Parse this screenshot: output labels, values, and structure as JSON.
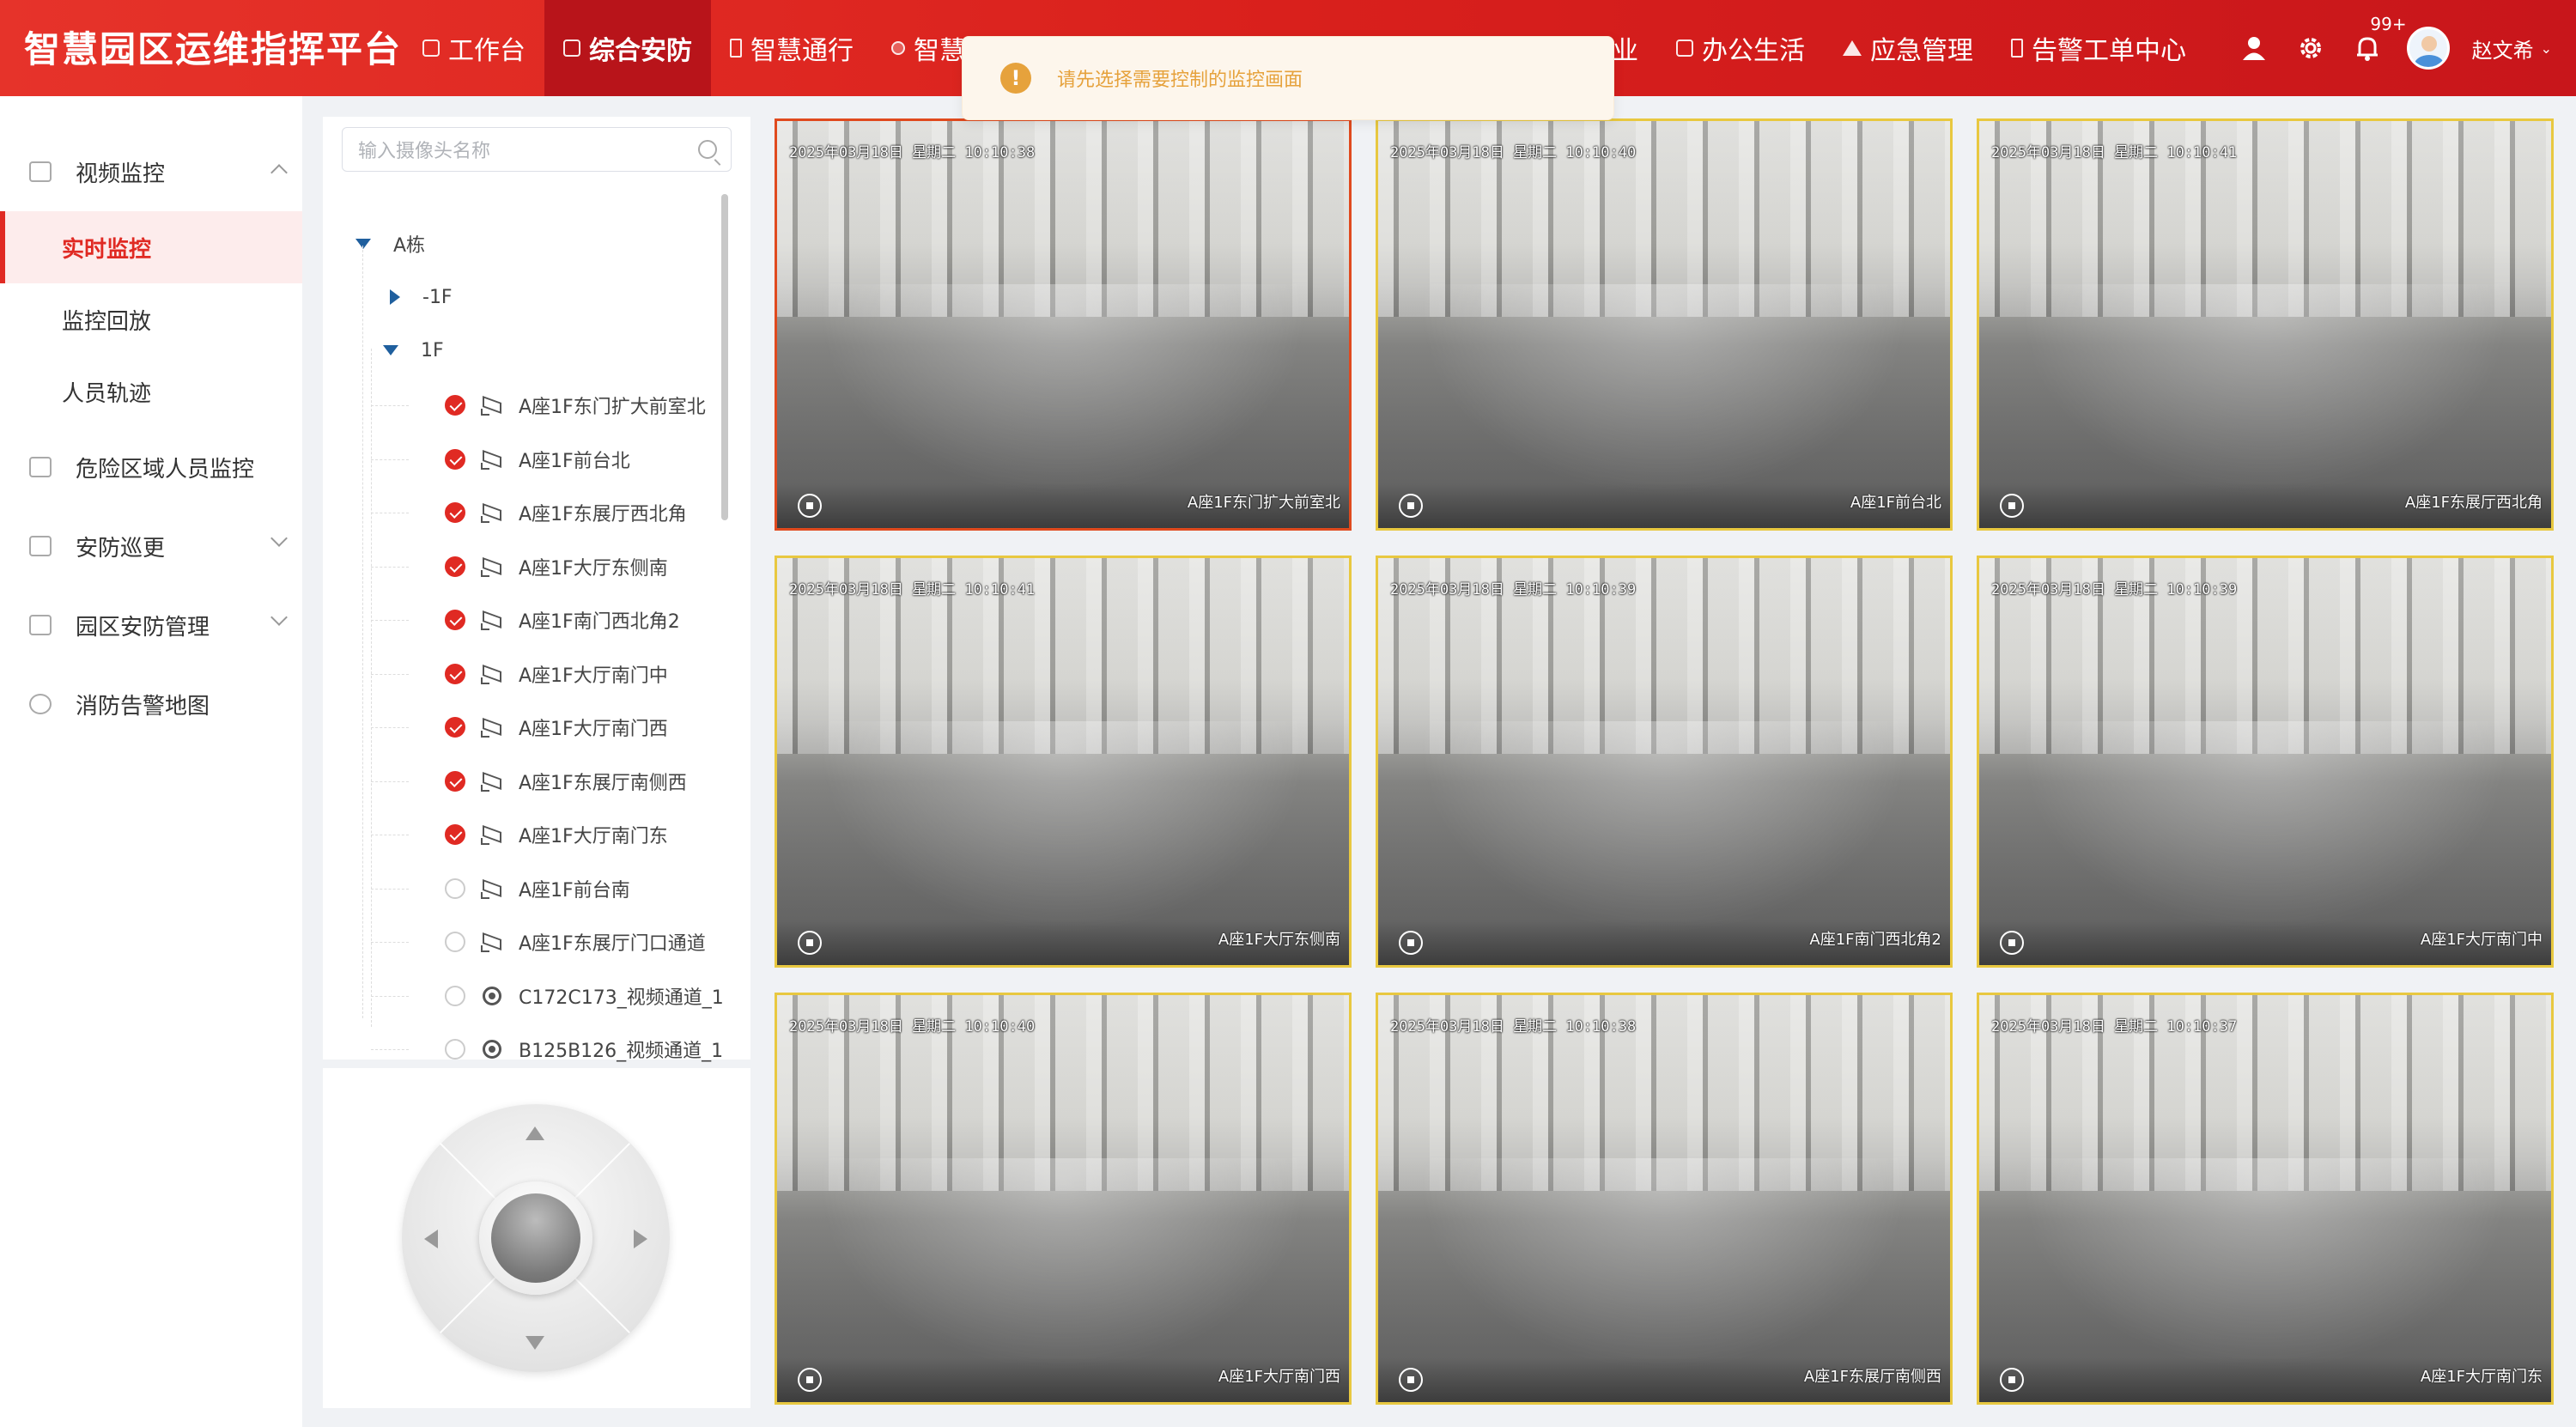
{
  "app": {
    "title": "智慧园区运维指挥平台"
  },
  "nav": [
    {
      "label": "工作台",
      "icon": "monitor-icon",
      "active": false
    },
    {
      "label": "综合安防",
      "icon": "shield-icon",
      "active": true
    },
    {
      "label": "智慧通行",
      "icon": "pass-icon",
      "active": false
    },
    {
      "label": "智慧能",
      "icon": "energy-icon",
      "active": false
    },
    {
      "label": "业",
      "icon": "",
      "active": false
    },
    {
      "label": "办公生活",
      "icon": "cup-icon",
      "active": false
    },
    {
      "label": "应急管理",
      "icon": "warning-icon",
      "active": false
    },
    {
      "label": "告警工单中心",
      "icon": "alarm-icon",
      "active": false
    }
  ],
  "header": {
    "badge": "99+",
    "username": "赵文希"
  },
  "toast": {
    "text": "请先选择需要控制的监控画面",
    "icon": "!"
  },
  "sidebar": {
    "video_monitor": "视频监控",
    "sub": [
      "实时监控",
      "监控回放",
      "人员轨迹"
    ],
    "items": [
      "危险区域人员监控",
      "安防巡更",
      "园区安防管理",
      "消防告警地图"
    ]
  },
  "tree": {
    "search_placeholder": "输入摄像头名称",
    "building": "A栋",
    "floors": [
      "-1F",
      "1F"
    ],
    "cameras": [
      {
        "name": "A座1F东门扩大前室北",
        "checked": true,
        "type": "bullet"
      },
      {
        "name": "A座1F前台北",
        "checked": true,
        "type": "bullet"
      },
      {
        "name": "A座1F东展厅西北角",
        "checked": true,
        "type": "bullet"
      },
      {
        "name": "A座1F大厅东侧南",
        "checked": true,
        "type": "bullet"
      },
      {
        "name": "A座1F南门西北角2",
        "checked": true,
        "type": "bullet"
      },
      {
        "name": "A座1F大厅南门中",
        "checked": true,
        "type": "bullet"
      },
      {
        "name": "A座1F大厅南门西",
        "checked": true,
        "type": "bullet"
      },
      {
        "name": "A座1F东展厅南侧西",
        "checked": true,
        "type": "bullet"
      },
      {
        "name": "A座1F大厅南门东",
        "checked": true,
        "type": "bullet"
      },
      {
        "name": "A座1F前台南",
        "checked": false,
        "type": "bullet"
      },
      {
        "name": "A座1F东展厅门口通道",
        "checked": false,
        "type": "bullet"
      },
      {
        "name": "C172C173_视频通道_1",
        "checked": false,
        "type": "dome"
      },
      {
        "name": "B125B126_视频通道_1",
        "checked": false,
        "type": "dome"
      }
    ]
  },
  "videos": [
    {
      "timestamp": "2025年03月18日 星期二 10:10:38",
      "name": "A座1F东门扩大前室北",
      "selected": true
    },
    {
      "timestamp": "2025年03月18日 星期二 10:10:40",
      "name": "A座1F前台北",
      "selected": false
    },
    {
      "timestamp": "2025年03月18日 星期二 10:10:41",
      "name": "A座1F东展厅西北角",
      "selected": false
    },
    {
      "timestamp": "2025年03月18日 星期二 10:10:41",
      "name": "A座1F大厅东侧南",
      "selected": false
    },
    {
      "timestamp": "2025年03月18日 星期二 10:10:39",
      "name": "A座1F南门西北角2",
      "selected": false
    },
    {
      "timestamp": "2025年03月18日 星期二 10:10:39",
      "name": "A座1F大厅南门中",
      "selected": false
    },
    {
      "timestamp": "2025年03月18日 星期二 10:10:40",
      "name": "A座1F大厅南门西",
      "selected": false
    },
    {
      "timestamp": "2025年03月18日 星期二 10:10:38",
      "name": "A座1F东展厅南侧西",
      "selected": false
    },
    {
      "timestamp": "2025年03月18日 星期二 10:10:37",
      "name": "A座1F大厅南门东",
      "selected": false
    }
  ],
  "colors": {
    "brand": "#d9201c",
    "accent_selected": "#e04a1e",
    "tile_border": "#e8c840",
    "warning": "#e6a23c"
  }
}
